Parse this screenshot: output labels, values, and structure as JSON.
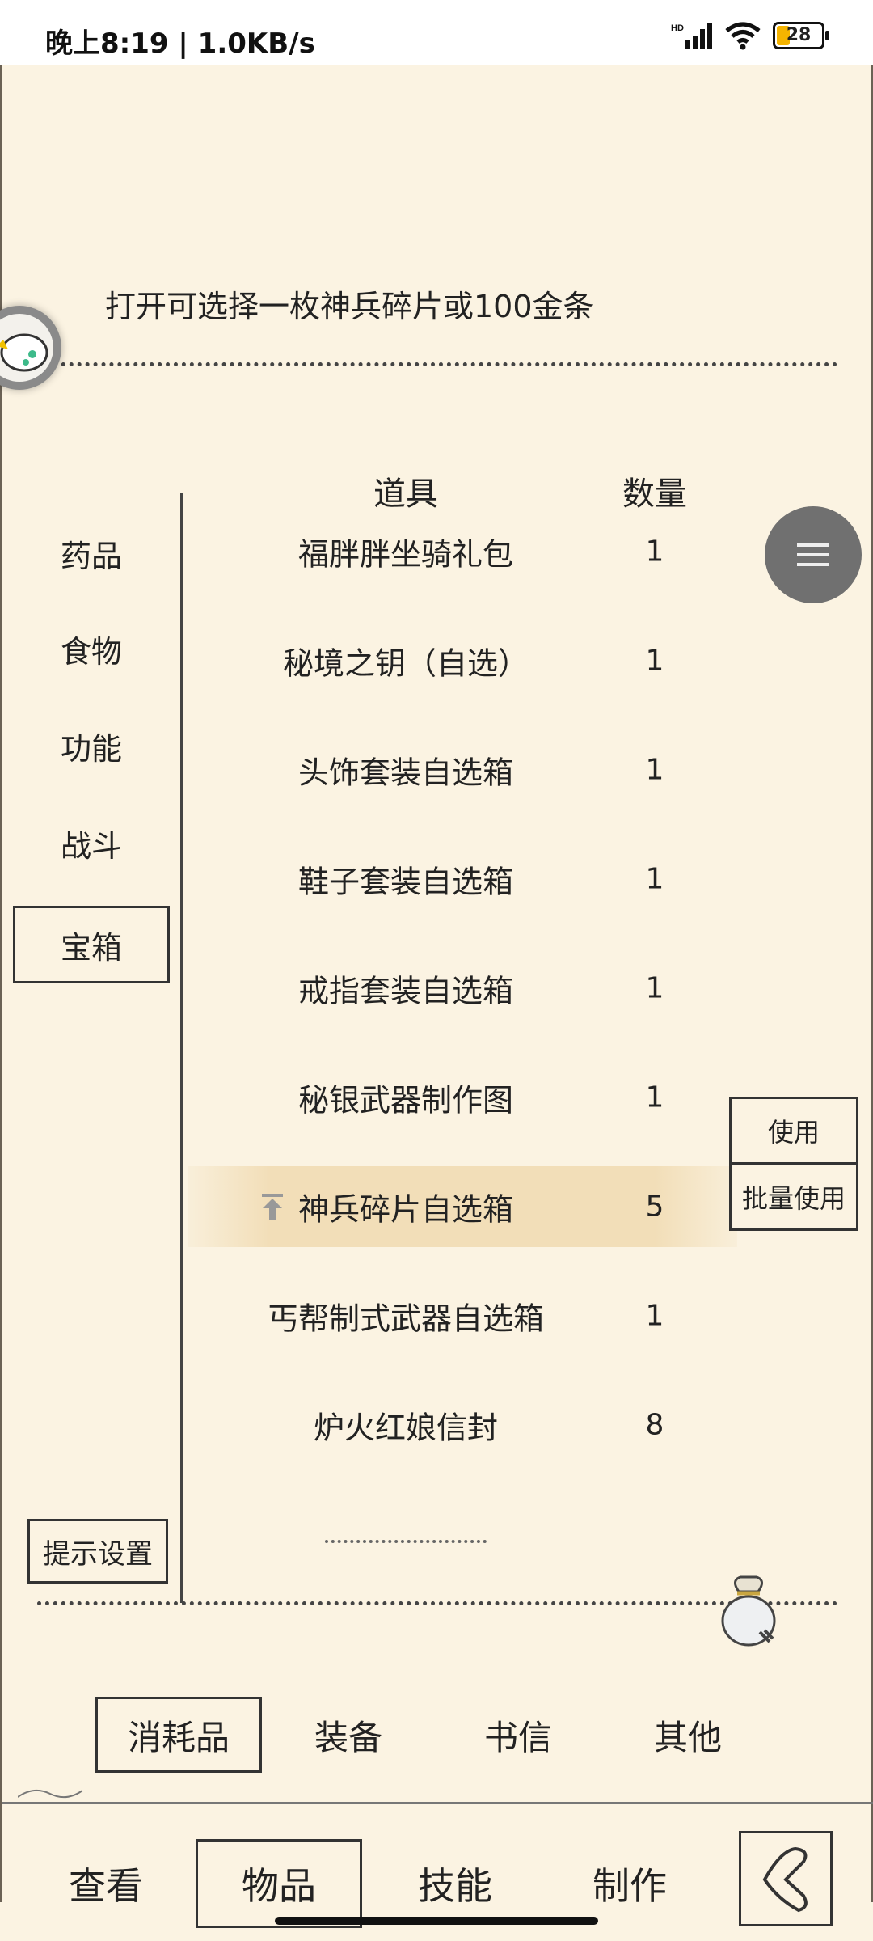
{
  "status": {
    "time": "晚上8:19 | 1.0KB/s",
    "battery": "28",
    "net_label": "HD"
  },
  "description": "打开可选择一枚神兵碎片或100金条",
  "categories": [
    {
      "label": "药品",
      "active": false
    },
    {
      "label": "食物",
      "active": false
    },
    {
      "label": "功能",
      "active": false
    },
    {
      "label": "战斗",
      "active": false
    },
    {
      "label": "宝箱",
      "active": true
    }
  ],
  "hint_settings": "提示设置",
  "table": {
    "headers": {
      "item": "道具",
      "qty": "数量"
    },
    "rows": [
      {
        "name": "福胖胖坐骑礼包",
        "qty": "1"
      },
      {
        "name": "秘境之钥（自选）",
        "qty": "1"
      },
      {
        "name": "头饰套装自选箱",
        "qty": "1"
      },
      {
        "name": "鞋子套装自选箱",
        "qty": "1"
      },
      {
        "name": "戒指套装自选箱",
        "qty": "1"
      },
      {
        "name": "秘银武器制作图",
        "qty": "1"
      },
      {
        "name": "神兵碎片自选箱",
        "qty": "5",
        "selected": true
      },
      {
        "name": "丐帮制式武器自选箱",
        "qty": "1"
      },
      {
        "name": "炉火红娘信封",
        "qty": "8"
      }
    ]
  },
  "actions": {
    "use": "使用",
    "batch_use": "批量使用"
  },
  "subtabs": [
    {
      "label": "消耗品",
      "active": true
    },
    {
      "label": "装备",
      "active": false
    },
    {
      "label": "书信",
      "active": false
    },
    {
      "label": "其他",
      "active": false
    }
  ],
  "nav": [
    {
      "label": "查看",
      "active": false
    },
    {
      "label": "物品",
      "active": true
    },
    {
      "label": "技能",
      "active": false
    },
    {
      "label": "制作",
      "active": false
    }
  ],
  "colors": {
    "background": "#fbf3e2",
    "selected_row": "#f2deb8",
    "fab": "#707070"
  }
}
